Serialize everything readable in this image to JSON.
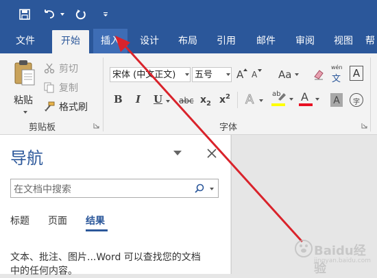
{
  "tabs": [
    {
      "label": "文件"
    },
    {
      "label": "开始"
    },
    {
      "label": "插入"
    },
    {
      "label": "设计"
    },
    {
      "label": "布局"
    },
    {
      "label": "引用"
    },
    {
      "label": "邮件"
    },
    {
      "label": "审阅"
    },
    {
      "label": "视图"
    },
    {
      "label": "帮"
    }
  ],
  "active_tab": "开始",
  "clipboard": {
    "paste": "粘贴",
    "cut": "剪切",
    "copy": "复制",
    "format_painter": "格式刷",
    "group_label": "剪贴板"
  },
  "font": {
    "font_name": "宋体 (中文正文)",
    "font_size": "五号",
    "change_case": "Aa",
    "group_label": "字体",
    "phonetic_top": "wén",
    "phonetic_bottom": "文",
    "bold": "B",
    "italic": "I",
    "underline": "U",
    "strikethrough": "abc",
    "subscript": "x",
    "subscript_index": "2",
    "superscript": "x",
    "superscript_index": "2",
    "text_effects": "A",
    "highlight_sample": "ab",
    "font_color": "A",
    "char_shading": "A",
    "enclose_char": "字",
    "char_border": "A",
    "grow": "A",
    "shrink": "A"
  },
  "navigation": {
    "title": "导航",
    "search_placeholder": "在文档中搜索",
    "tabs": [
      "标题",
      "页面",
      "结果"
    ],
    "active_tab": "结果",
    "message_line1": "文本、批注、图片...Word 可以查找您的文档",
    "message_line2": "中的任何内容。"
  },
  "watermark": {
    "text": "Baidu经验",
    "sub": "jingyan.baidu.com"
  },
  "colors": {
    "ribbon_blue": "#2b579a",
    "annotation_arrow": "#d9232b",
    "highlight_yellow": "#ffff00",
    "font_color_red": "#e81123"
  }
}
